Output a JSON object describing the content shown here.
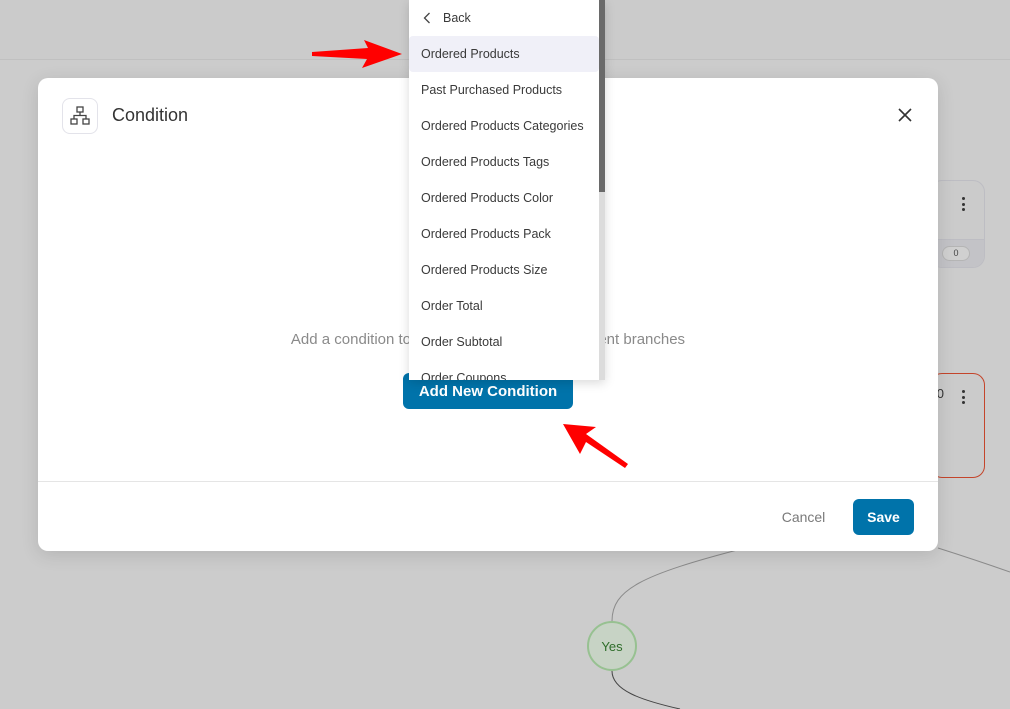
{
  "background": {
    "nodes": [
      {
        "kind": "grey",
        "count": "0"
      },
      {
        "kind": "red",
        "partial_text": "0"
      }
    ],
    "yes_node_label": "Yes"
  },
  "modal": {
    "title": "Condition",
    "icon": "sitemap-icon",
    "empty_text": "Add a condition to segment contacts into different branches",
    "add_button": "Add New Condition",
    "cancel_button": "Cancel",
    "save_button": "Save"
  },
  "dropdown": {
    "back_label": "Back",
    "selected": "Ordered Products",
    "items": [
      "Ordered Products",
      "Past Purchased Products",
      "Ordered Products Categories",
      "Ordered Products Tags",
      "Ordered Products Color",
      "Ordered Products Pack",
      "Ordered Products Size",
      "Order Total",
      "Order Subtotal",
      "Order Coupons"
    ]
  },
  "colors": {
    "primary": "#0073aa",
    "annotation_arrow": "#ff0000",
    "overlay": "#cccccc",
    "yes_node_text": "#2e6d2a",
    "red_node_border": "#c4452b"
  }
}
